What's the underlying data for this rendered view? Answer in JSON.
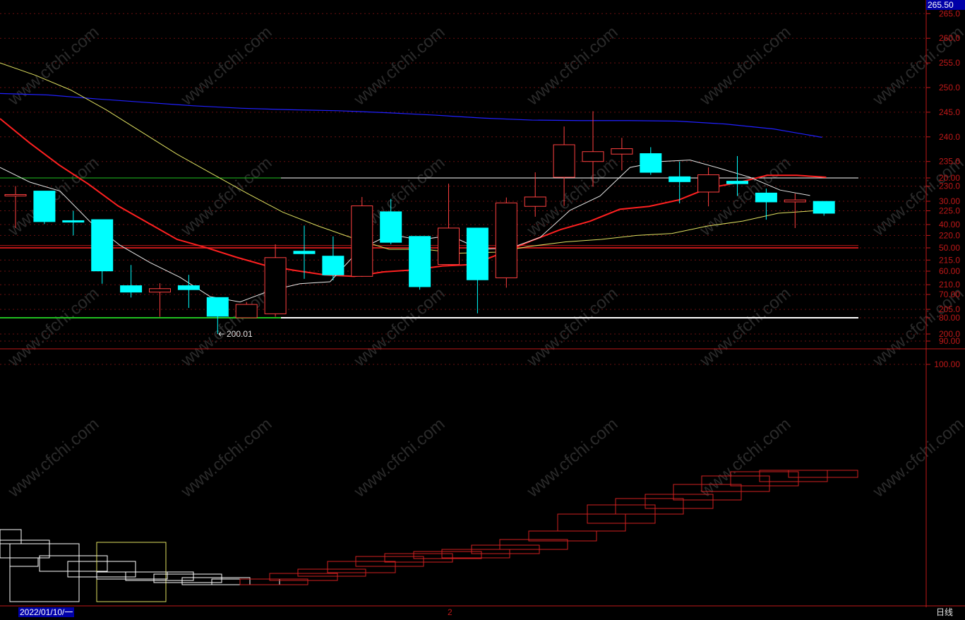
{
  "price_top_label": "265.50",
  "date_start": "2022/01/10/一",
  "page_marker": "2",
  "period": "日线",
  "low_marker_label": "200.01",
  "colors": {
    "background": "#000000",
    "axis": "#c01818",
    "grid": "#6a1010",
    "up_candle": "#ff4040",
    "down_candle": "#00ffff",
    "ma_white": "#e8e8e8",
    "ma_red": "#ff2020",
    "ma_yellow": "#e0e060",
    "ma_blue": "#2020ff"
  },
  "chart_data": [
    {
      "type": "candlestick",
      "panel": "price",
      "ylim": [
        197.5,
        265.5
      ],
      "y_ticks": [
        "265.0",
        "260.0",
        "255.0",
        "250.0",
        "245.0",
        "240.0",
        "235.0",
        "230.0",
        "225.0",
        "220.0",
        "215.0",
        "210.0",
        "205.0",
        "200.0"
      ],
      "candles": [
        {
          "o": 228.0,
          "h": 230.0,
          "l": 221.5,
          "c": 228.3
        },
        {
          "o": 229.0,
          "h": 229.0,
          "l": 222.3,
          "c": 222.8
        },
        {
          "o": 223.0,
          "h": 225.0,
          "l": 220.0,
          "c": 222.7
        },
        {
          "o": 223.2,
          "h": 223.2,
          "l": 210.2,
          "c": 212.8
        },
        {
          "o": 209.8,
          "h": 214.0,
          "l": 207.4,
          "c": 208.5
        },
        {
          "o": 208.5,
          "h": 210.3,
          "l": 203.5,
          "c": 209.2
        },
        {
          "o": 209.8,
          "h": 212.0,
          "l": 205.3,
          "c": 209.0
        },
        {
          "o": 207.4,
          "h": 207.4,
          "l": 200.01,
          "c": 203.6
        },
        {
          "o": 203.3,
          "h": 206.5,
          "l": 203.3,
          "c": 206.0
        },
        {
          "o": 204.1,
          "h": 218.2,
          "l": 203.5,
          "c": 215.5
        },
        {
          "o": 216.8,
          "h": 222.0,
          "l": 211.2,
          "c": 216.3
        },
        {
          "o": 215.8,
          "h": 219.8,
          "l": 210.9,
          "c": 212.0
        },
        {
          "o": 211.7,
          "h": 227.8,
          "l": 211.6,
          "c": 226.0
        },
        {
          "o": 224.8,
          "h": 227.4,
          "l": 218.2,
          "c": 218.6
        },
        {
          "o": 219.8,
          "h": 219.8,
          "l": 209.0,
          "c": 209.6
        },
        {
          "o": 214.1,
          "h": 230.5,
          "l": 214.0,
          "c": 221.5
        },
        {
          "o": 221.5,
          "h": 221.5,
          "l": 204.2,
          "c": 211.0
        },
        {
          "o": 211.4,
          "h": 227.7,
          "l": 209.4,
          "c": 226.6
        },
        {
          "o": 225.9,
          "h": 232.8,
          "l": 223.8,
          "c": 227.8
        },
        {
          "o": 231.8,
          "h": 242.1,
          "l": 226.0,
          "c": 238.4
        },
        {
          "o": 235.0,
          "h": 245.2,
          "l": 229.9,
          "c": 237.0
        },
        {
          "o": 236.5,
          "h": 239.8,
          "l": 233.2,
          "c": 237.6
        },
        {
          "o": 236.6,
          "h": 237.9,
          "l": 232.3,
          "c": 232.8
        },
        {
          "o": 231.9,
          "h": 235.0,
          "l": 226.5,
          "c": 230.9
        },
        {
          "o": 228.8,
          "h": 233.8,
          "l": 225.9,
          "c": 232.3
        },
        {
          "o": 231.0,
          "h": 236.1,
          "l": 228.0,
          "c": 230.5
        },
        {
          "o": 228.6,
          "h": 229.5,
          "l": 223.2,
          "c": 226.8
        },
        {
          "o": 226.8,
          "h": 228.5,
          "l": 221.5,
          "c": 227.2
        },
        {
          "o": 226.9,
          "h": 226.9,
          "l": 224.0,
          "c": 224.5
        }
      ],
      "ma_white": [
        233.8,
        230.8,
        229.0,
        222.8,
        218.0,
        214.5,
        211.5,
        207.6,
        206.5,
        208.8,
        210.2,
        210.6,
        217.2,
        220.2,
        219.1,
        220.0,
        217.2,
        217.4,
        219.6,
        225.1,
        228.0,
        233.8,
        235.0,
        235.3,
        233.6,
        231.8,
        229.2,
        228.1
      ],
      "ma_red": [
        243.7,
        238.8,
        234.3,
        230.4,
        226.0,
        222.6,
        219.2,
        217.5,
        215.6,
        213.9,
        212.9,
        212.0,
        211.7,
        212.6,
        213.0,
        213.8,
        214.1,
        216.4,
        218.9,
        221.2,
        222.9,
        225.3,
        225.9,
        227.2,
        229.6,
        230.7,
        232.2,
        232.2,
        231.8
      ],
      "ma_yellow": [
        255.0,
        252.5,
        249.5,
        245.5,
        241.0,
        236.5,
        232.5,
        228.5,
        224.7,
        221.9,
        219.4,
        217.2,
        217.2,
        216.4,
        216.6,
        217.8,
        218.7,
        219.2,
        220.0,
        220.4,
        221.9,
        222.9,
        224.5,
        225.0
      ],
      "ma_yellow_start_index": 0,
      "ma_blue": [
        248.8,
        248.5,
        247.7,
        247.0,
        246.3,
        245.8,
        245.5,
        245.3,
        244.9,
        244.4,
        243.8,
        243.4,
        243.3,
        243.3,
        243.2,
        242.6,
        241.6,
        239.9
      ]
    },
    {
      "type": "indicator",
      "panel": "lower",
      "ylim": [
        5,
        105
      ],
      "y_ticks": [
        "100.00",
        "90.00",
        "80.00",
        "70.00",
        "60.00",
        "50.00",
        "40.00",
        "30.00",
        "20.00"
      ],
      "reference_lines": [
        80,
        50,
        20
      ]
    }
  ]
}
